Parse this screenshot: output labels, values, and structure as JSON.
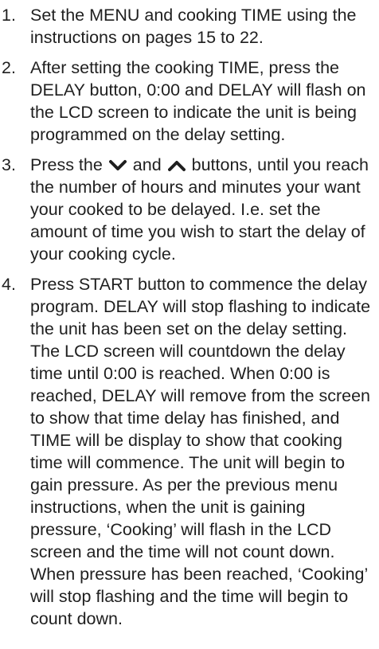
{
  "steps": [
    {
      "number": "1.",
      "text": "Set the MENU and cooking TIME using the instructions on pages 15 to 22."
    },
    {
      "number": "2.",
      "text": "After setting the cooking TIME, press the DELAY button, 0:00 and DELAY will flash on the LCD screen to indicate the unit is being programmed on the delay setting."
    },
    {
      "number": "3.",
      "text_before": "Press the",
      "icon_down": "chevron-down-icon",
      "text_and": "and",
      "icon_up": "chevron-up-icon",
      "text_after": "buttons, until you reach the number of hours and minutes your want your cooked to be delayed. I.e. set the amount of time you wish to start the delay of your cooking cycle."
    },
    {
      "number": "4.",
      "text": "Press START button to commence the delay program. DELAY will stop flashing to indicate the unit has been set on the delay setting. The LCD screen will countdown the delay time until 0:00 is reached. When 0:00 is reached, DELAY will remove from the screen to show that time delay has finished, and TIME will be display to show that cooking time will commence. The unit will begin to gain pressure. As per the previous menu instructions, when the unit is gaining pressure, ‘Cooking’ will flash in the LCD screen and the time will not count down. When pressure has been reached, ‘Cooking’ will stop flashing and the time will begin to count down."
    }
  ]
}
